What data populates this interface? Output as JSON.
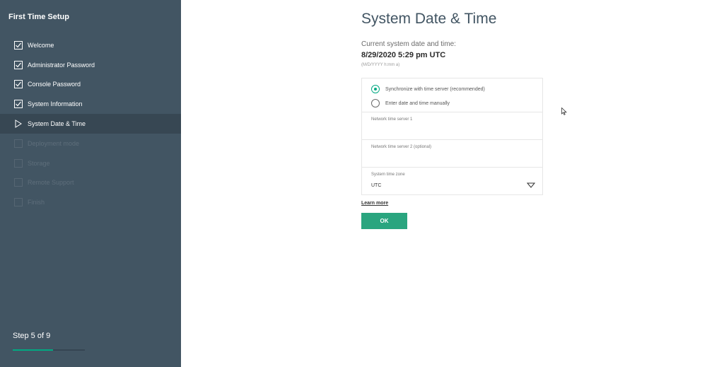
{
  "sidebar": {
    "title": "First Time Setup",
    "steps": [
      {
        "label": "Welcome",
        "state": "done"
      },
      {
        "label": "Administrator Password",
        "state": "done"
      },
      {
        "label": "Console Password",
        "state": "done"
      },
      {
        "label": "System Information",
        "state": "done"
      },
      {
        "label": "System Date & Time",
        "state": "active"
      },
      {
        "label": "Deployment mode",
        "state": "pending"
      },
      {
        "label": "Storage",
        "state": "pending"
      },
      {
        "label": "Remote Support",
        "state": "pending"
      },
      {
        "label": "Finish",
        "state": "pending"
      }
    ],
    "step_count": "Step 5 of 9",
    "progress_fraction": 0.556
  },
  "main": {
    "title": "System Date & Time",
    "current_label": "Current system date and time:",
    "current_value": "8/29/2020 5:29 pm UTC",
    "format_hint": "(M/D/YYYY h:mm a)",
    "options": {
      "sync_label": "Synchronize with time server (recommended)",
      "manual_label": "Enter date and time manually",
      "selected": "sync"
    },
    "ntp1_label": "Network time server 1",
    "ntp2_label": "Network time server 2 (optional)",
    "timezone_label": "System time zone",
    "timezone_value": "UTC",
    "learn_more": "Learn more",
    "ok_label": "OK"
  },
  "colors": {
    "sidebar_bg": "#425563",
    "active_bg": "#374753",
    "accent": "#01a982",
    "button": "#2aa57f"
  }
}
